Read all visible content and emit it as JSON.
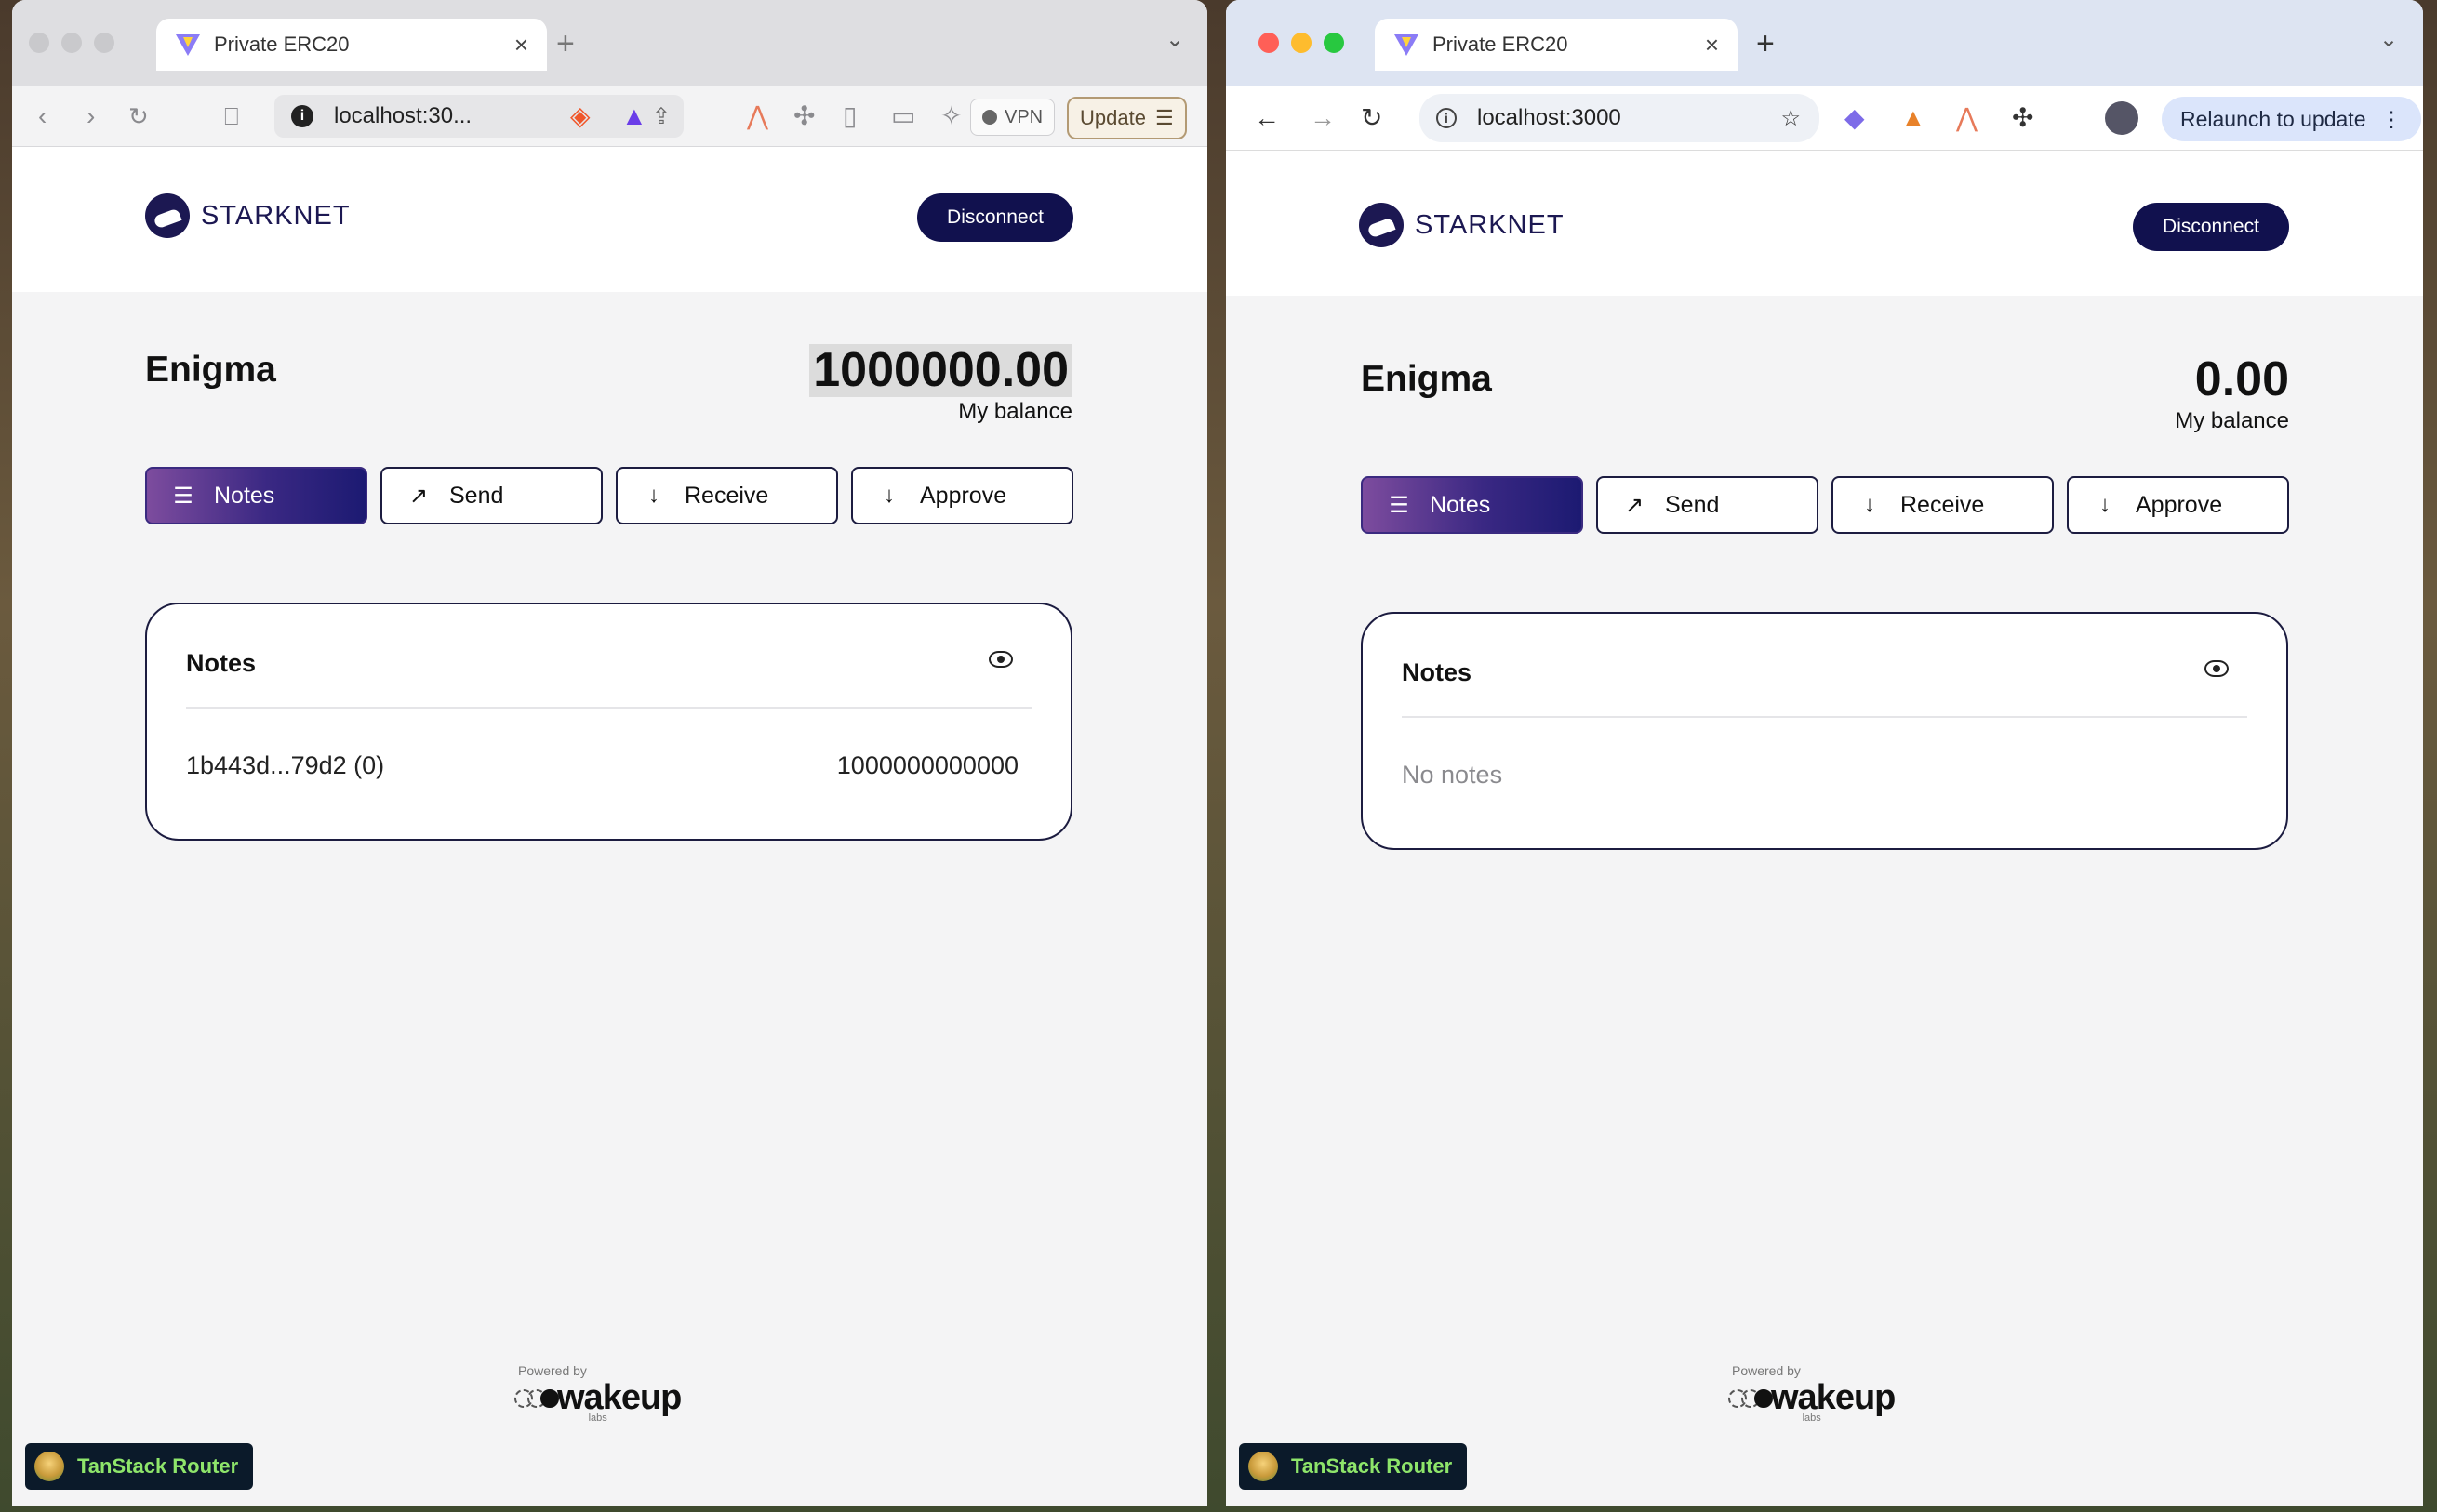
{
  "left_window": {
    "tab_title": "Private ERC20",
    "url": "localhost:30...",
    "vpn_label": "VPN",
    "update_label": "Update",
    "app": {
      "brand": "STARKNET",
      "disconnect_label": "Disconnect",
      "title": "Enigma",
      "balance": "1000000.00",
      "balance_label": "My balance",
      "actions": [
        "Notes",
        "Send",
        "Receive",
        "Approve"
      ],
      "notes": {
        "heading": "Notes",
        "items": [
          {
            "id": "1b443d...79d2 (0)",
            "amount": "1000000000000"
          }
        ]
      },
      "powered_by": "Powered by",
      "powered_brand": "wakeup",
      "powered_sub": "labs",
      "devtools_label": "TanStack Router"
    }
  },
  "right_window": {
    "tab_title": "Private ERC20",
    "url": "localhost:3000",
    "relaunch_label": "Relaunch to update",
    "app": {
      "brand": "STARKNET",
      "disconnect_label": "Disconnect",
      "title": "Enigma",
      "balance": "0.00",
      "balance_label": "My balance",
      "actions": [
        "Notes",
        "Send",
        "Receive",
        "Approve"
      ],
      "notes": {
        "heading": "Notes",
        "empty_text": "No notes"
      },
      "powered_by": "Powered by",
      "powered_brand": "wakeup",
      "powered_sub": "labs",
      "devtools_label": "TanStack Router"
    }
  },
  "colors": {
    "brand_navy": "#11114e",
    "active_gradient_start": "#7d4c9e",
    "active_gradient_end": "#1c1a72",
    "page_bg": "#f4f4f5"
  },
  "icons": {
    "notes": "list-icon",
    "send": "arrow-up-right-icon",
    "receive": "arrow-down-icon",
    "approve": "arrow-down-icon",
    "visibility": "eye-icon"
  }
}
